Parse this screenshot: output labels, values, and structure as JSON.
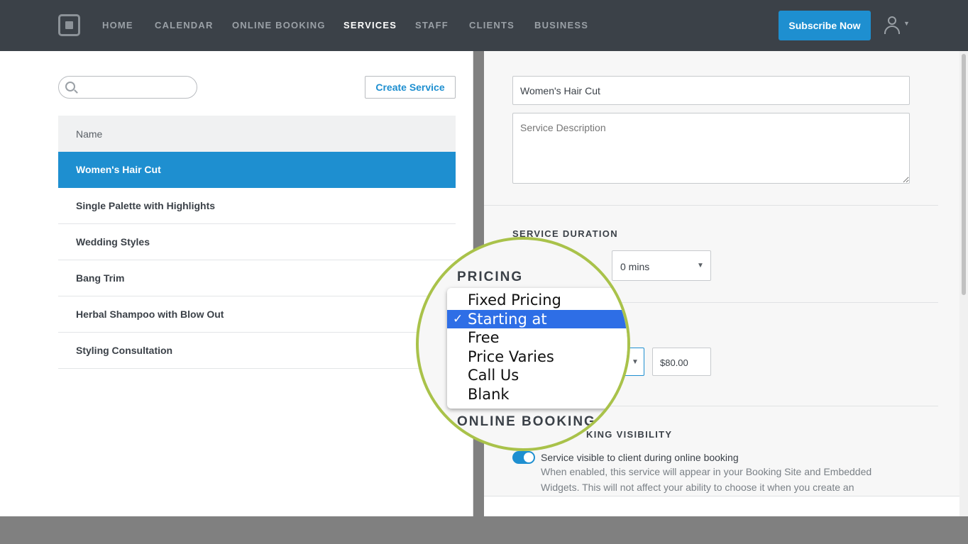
{
  "nav": {
    "items": [
      "HOME",
      "CALENDAR",
      "ONLINE BOOKING",
      "SERVICES",
      "STAFF",
      "CLIENTS",
      "BUSINESS"
    ],
    "active": "SERVICES",
    "subscribe_label": "Subscribe Now"
  },
  "services_list": {
    "search_placeholder": "",
    "create_label": "Create Service",
    "column_name": "Name",
    "rows": [
      "Women's Hair Cut",
      "Single Palette with Highlights",
      "Wedding Styles",
      "Bang Trim",
      "Herbal Shampoo with Blow Out",
      "Styling Consultation"
    ],
    "selected": "Women's Hair Cut"
  },
  "editor": {
    "name_value": "Women's Hair Cut",
    "description_placeholder": "Service Description",
    "duration_title": "SERVICE DURATION",
    "duration_mins": "0 mins",
    "price_value": "$80.00",
    "visibility_title_partial": "KING VISIBILITY",
    "visibility_label": "Service visible to client during online booking",
    "visibility_help": "When enabled, this service will appear in your Booking Site and Embedded Widgets. This will not affect your ability to choose it when you create an"
  },
  "magnifier": {
    "pricing_title": "PRICING",
    "pricing_options": [
      "Fixed Pricing",
      "Starting at",
      "Free",
      "Price Varies",
      "Call Us",
      "Blank"
    ],
    "selected_option": "Starting at",
    "check_mark": "✓",
    "next_section_partial": "ONLINE BOOKING V"
  },
  "colors": {
    "topbar": "#3b4148",
    "accent": "#1e8fd0",
    "magnifier_ring": "#a9c24a",
    "dropdown_highlight": "#2e6ee6"
  }
}
